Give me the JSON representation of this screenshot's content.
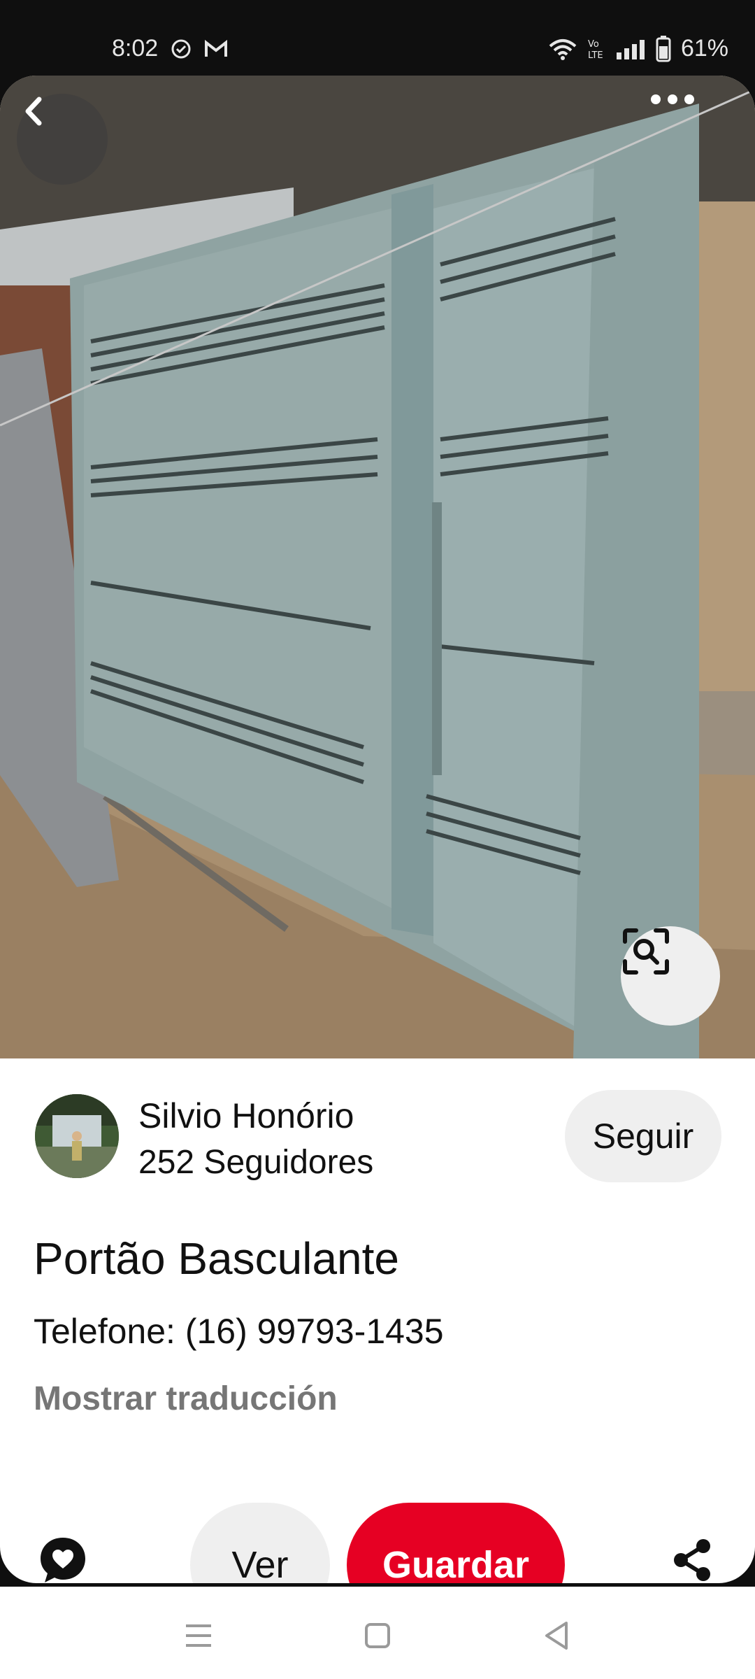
{
  "status_bar": {
    "time": "8:02",
    "battery": "61%",
    "icons": [
      "check-circle-icon",
      "gmail-icon",
      "wifi-icon",
      "volte-icon",
      "signal-icon",
      "battery-icon"
    ]
  },
  "pin": {
    "image_description_icon": "gate-photo",
    "creator": {
      "name": "Silvio Honório",
      "followers": "252 Seguidores"
    },
    "follow_label": "Seguir",
    "title": "Portão Basculante",
    "description": "Telefone: (16) 99793-1435",
    "translate_label": "Mostrar traducción"
  },
  "actions": {
    "view_label": "Ver",
    "save_label": "Guardar"
  },
  "colors": {
    "save": "#e60023",
    "pill": "#efefef",
    "muted": "#767676"
  }
}
